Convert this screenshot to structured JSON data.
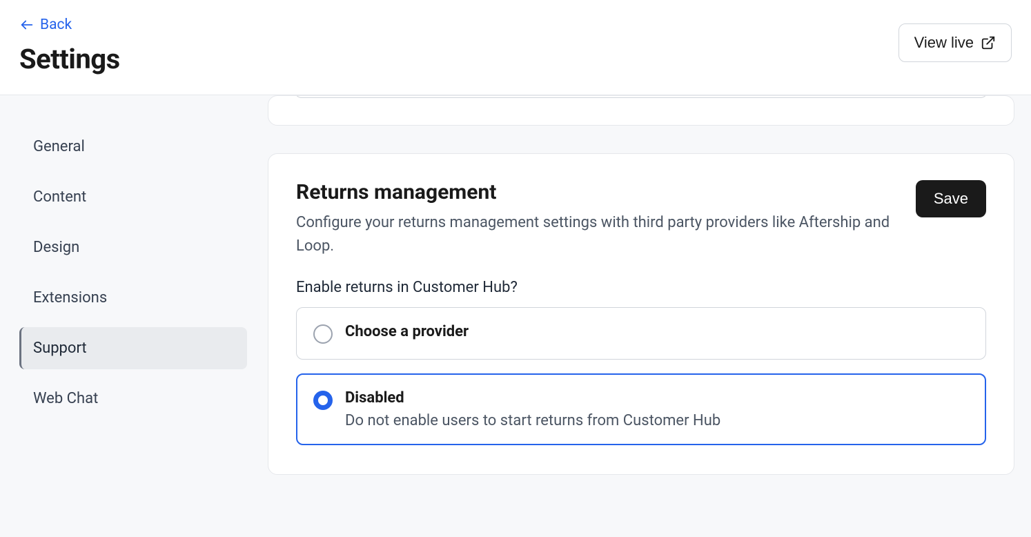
{
  "header": {
    "back_label": "Back",
    "page_title": "Settings",
    "view_live_label": "View live"
  },
  "sidebar": {
    "items": [
      {
        "label": "General",
        "active": false
      },
      {
        "label": "Content",
        "active": false
      },
      {
        "label": "Design",
        "active": false
      },
      {
        "label": "Extensions",
        "active": false
      },
      {
        "label": "Support",
        "active": true
      },
      {
        "label": "Web Chat",
        "active": false
      }
    ]
  },
  "main": {
    "card": {
      "title": "Returns management",
      "description": "Configure your returns management settings with third party providers like Aftership and Loop.",
      "save_label": "Save",
      "field_label": "Enable returns in Customer Hub?",
      "options": [
        {
          "title": "Choose a provider",
          "subtitle": "",
          "selected": false
        },
        {
          "title": "Disabled",
          "subtitle": "Do not enable users to start returns from Customer Hub",
          "selected": true
        }
      ]
    }
  }
}
